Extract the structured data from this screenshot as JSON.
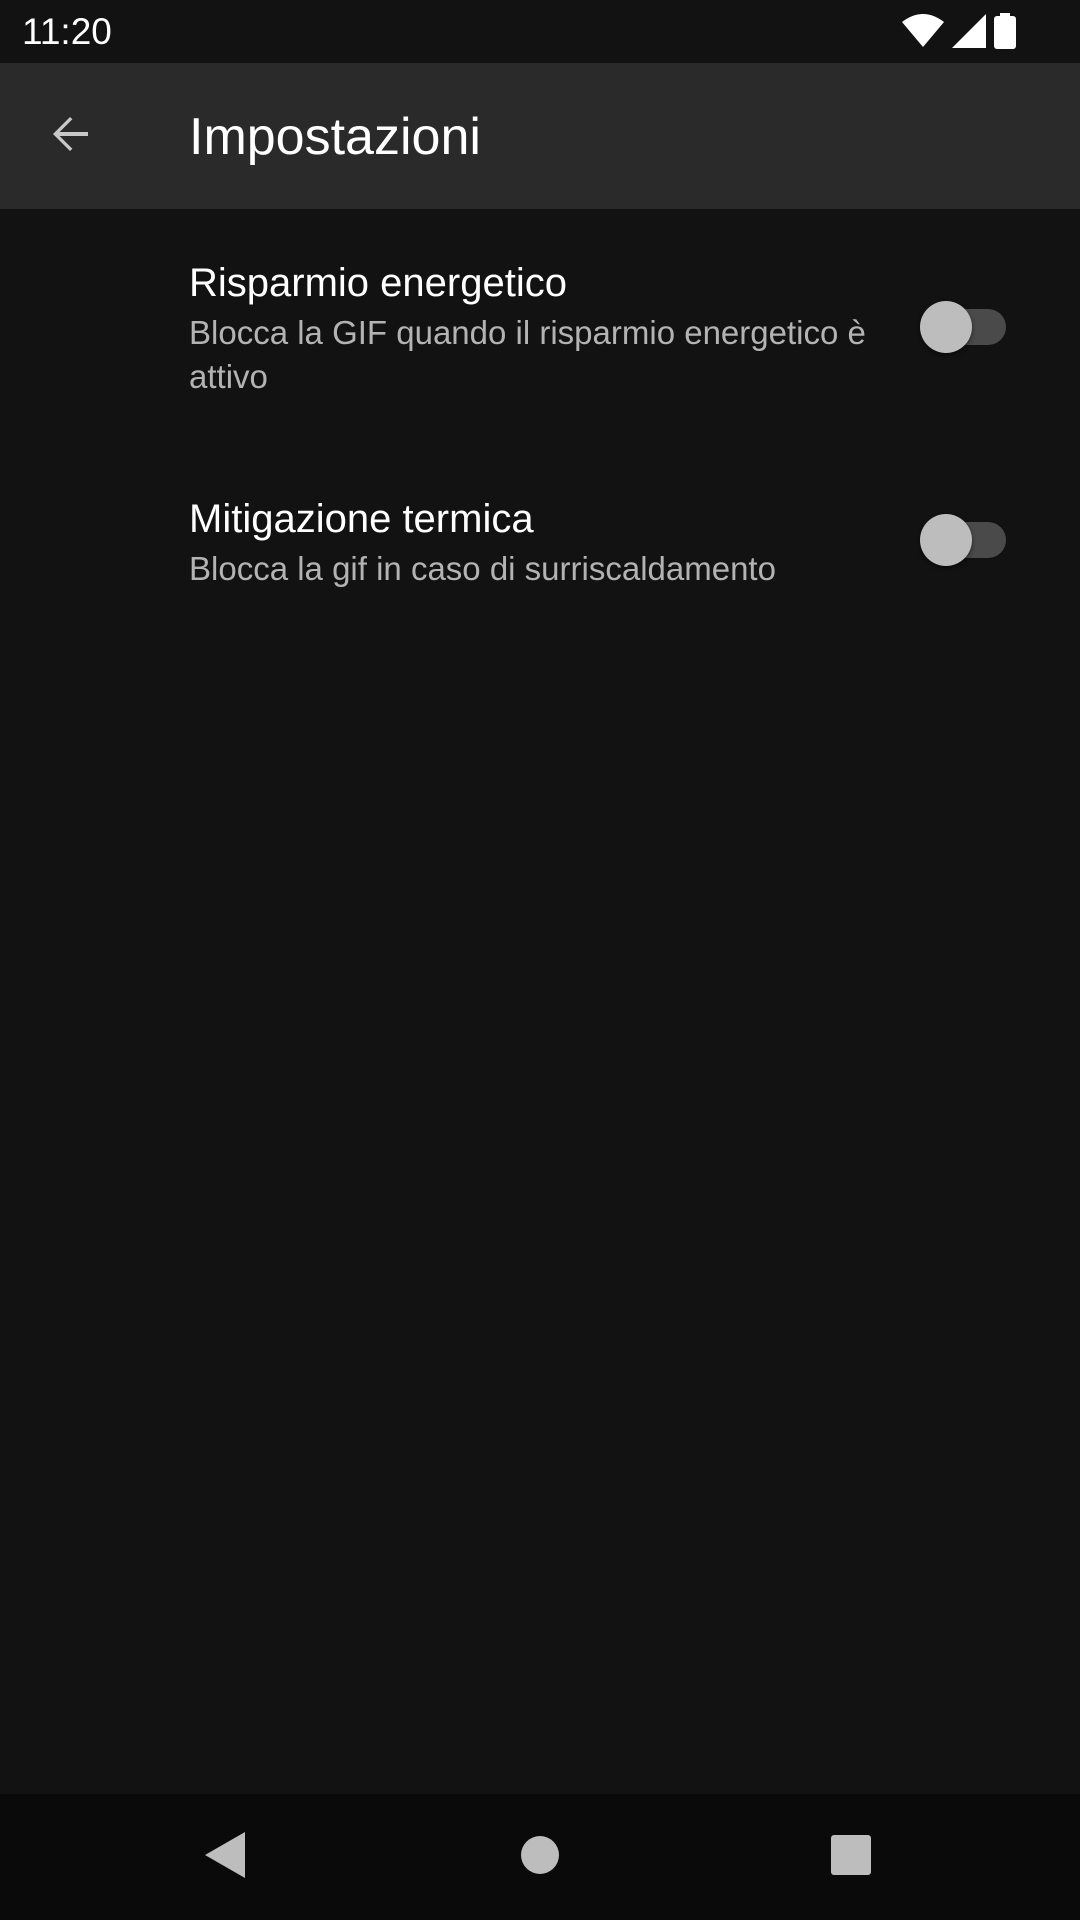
{
  "status_bar": {
    "time": "11:20",
    "icons": [
      "wifi-icon",
      "signal-icon",
      "battery-icon"
    ]
  },
  "app_bar": {
    "title": "Impostazioni",
    "back_icon": "arrow-back-icon"
  },
  "settings": [
    {
      "title": "Risparmio energetico",
      "summary": "Blocca la GIF quando il risparmio energetico è attivo",
      "enabled": false
    },
    {
      "title": "Mitigazione termica",
      "summary": "Blocca la gif in caso di surriscaldamento",
      "enabled": false
    }
  ],
  "navigation_bar": {
    "buttons": [
      "back-triangle-icon",
      "home-circle-icon",
      "recents-square-icon"
    ]
  },
  "colors": {
    "background": "#121212",
    "app_bar": "#2a2a2a",
    "nav_bar": "#0a0a0a",
    "text_primary": "#ffffff",
    "text_secondary": "#b3b3b3",
    "switch_thumb_off": "#bdbdbd",
    "switch_track_off": "#4a4a4a"
  }
}
